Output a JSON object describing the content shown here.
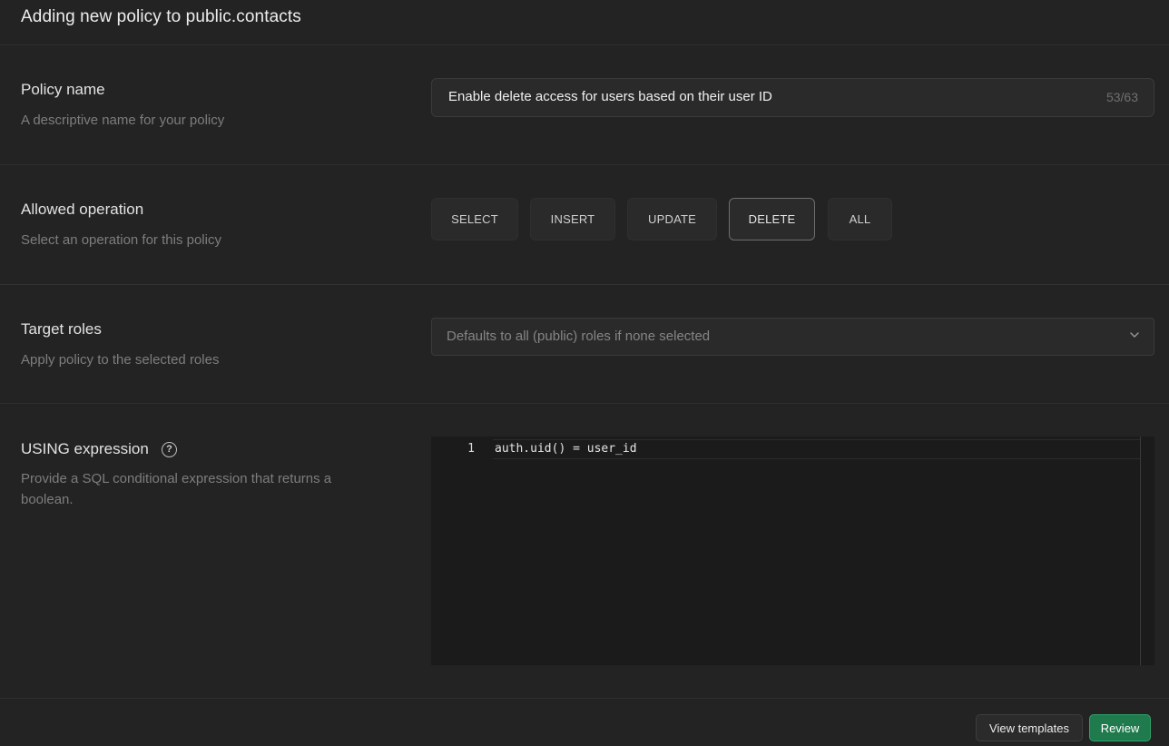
{
  "header": {
    "title": "Adding new policy to public.contacts"
  },
  "policy_name": {
    "label": "Policy name",
    "description": "A descriptive name for your policy",
    "value": "Enable delete access for users based on their user ID",
    "counter": "53/63"
  },
  "allowed_operation": {
    "label": "Allowed operation",
    "description": "Select an operation for this policy",
    "options": [
      "SELECT",
      "INSERT",
      "UPDATE",
      "DELETE",
      "ALL"
    ],
    "selected": "DELETE"
  },
  "target_roles": {
    "label": "Target roles",
    "description": "Apply policy to the selected roles",
    "placeholder": "Defaults to all (public) roles if none selected",
    "icon": "chevron-down-icon"
  },
  "using_expression": {
    "label": "USING expression",
    "help_icon": "help-circle-icon",
    "description_line1": "Provide a SQL conditional expression that returns a",
    "description_line2": "boolean.",
    "line_number": "1",
    "code": "auth.uid() = user_id"
  },
  "footer": {
    "view_templates_label": "View templates",
    "review_label": "Review"
  },
  "colors": {
    "background": "#232323",
    "review_button": "#1f7a4d",
    "editor_background": "#1b1b1b"
  }
}
